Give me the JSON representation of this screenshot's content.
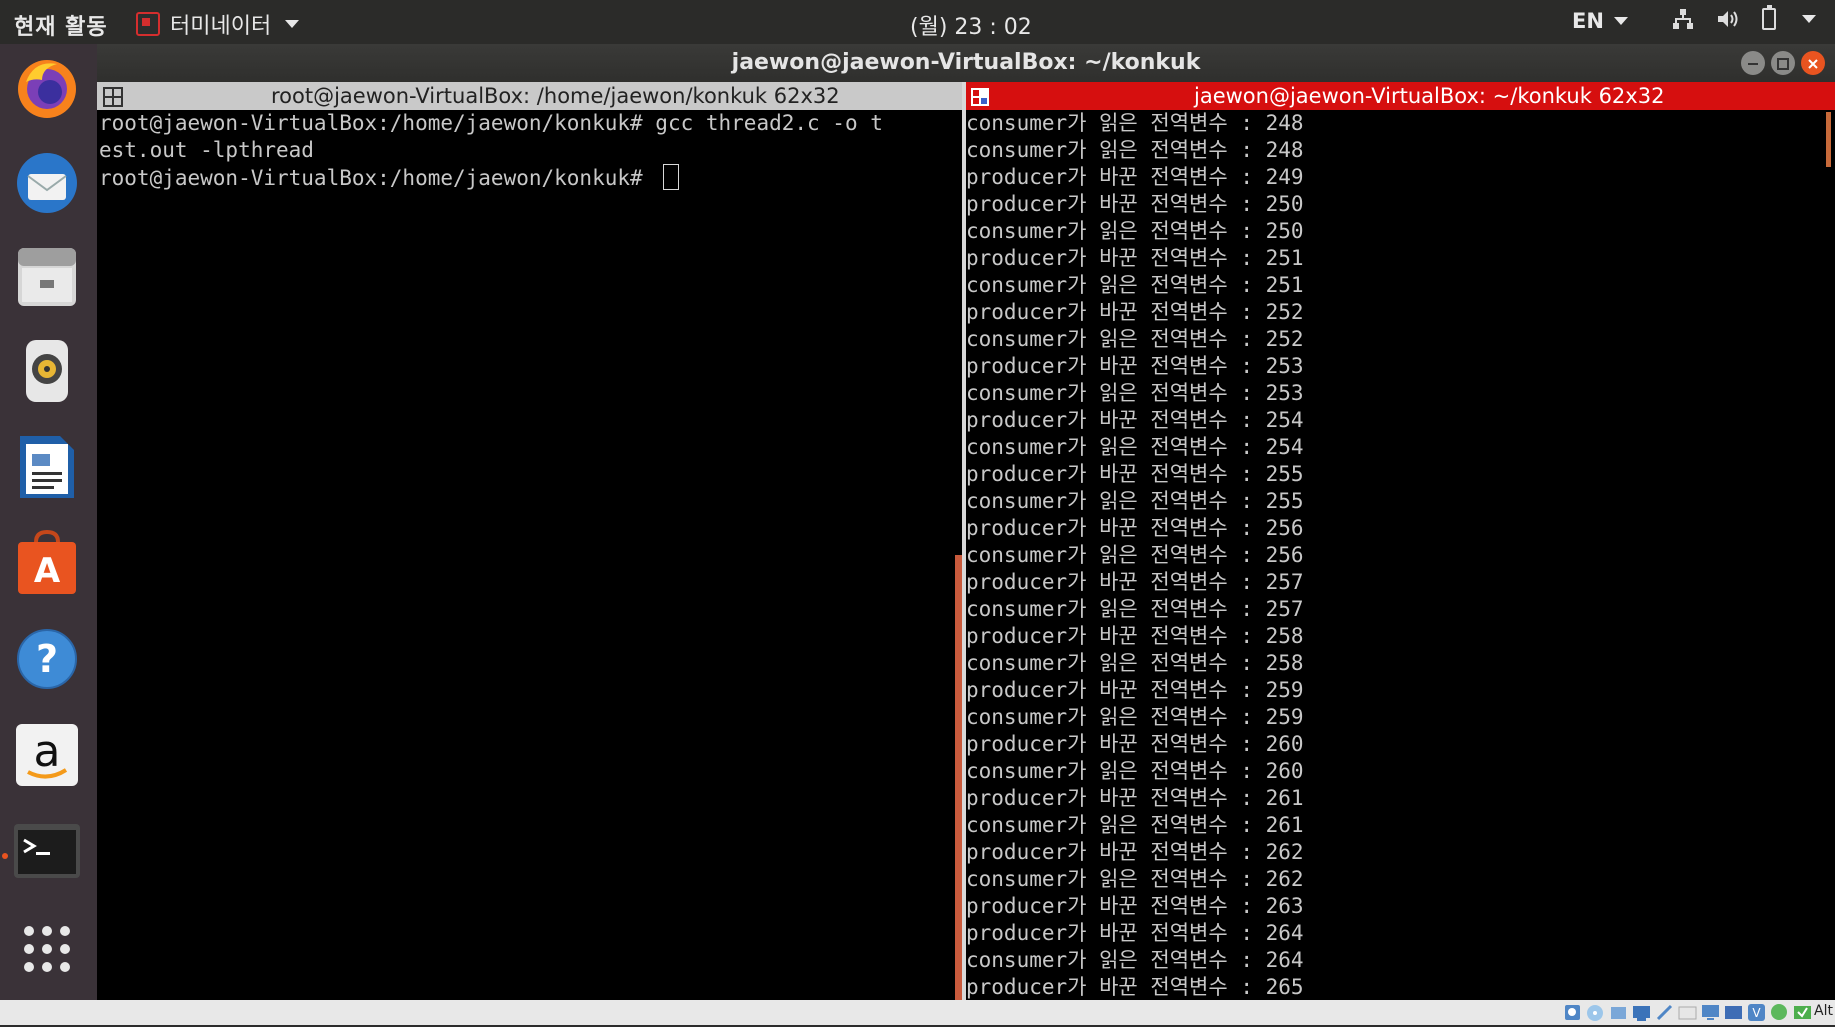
{
  "topbar": {
    "activities": "현재 활동",
    "app_menu": "터미네이터",
    "clock": "(월) 23 : 02",
    "language": "EN"
  },
  "dock": {
    "items": [
      "firefox",
      "thunderbird",
      "files",
      "rhythmbox",
      "writer",
      "software",
      "help",
      "amazon",
      "terminal",
      "show-apps"
    ]
  },
  "window": {
    "title": "jaewon@jaewon-VirtualBox: ~/konkuk"
  },
  "left_pane": {
    "title": "root@jaewon-VirtualBox: /home/jaewon/konkuk 62x32",
    "lines": [
      "root@jaewon-VirtualBox:/home/jaewon/konkuk# gcc thread2.c -o t",
      "est.out -lpthread",
      "root@jaewon-VirtualBox:/home/jaewon/konkuk# "
    ]
  },
  "right_pane": {
    "title": "jaewon@jaewon-VirtualBox: ~/konkuk 62x32",
    "lines": [
      "consumer가 읽은 전역변수 : 248",
      "consumer가 읽은 전역변수 : 248",
      "producer가 바꾼 전역변수 : 249",
      "producer가 바꾼 전역변수 : 250",
      "consumer가 읽은 전역변수 : 250",
      "producer가 바꾼 전역변수 : 251",
      "consumer가 읽은 전역변수 : 251",
      "producer가 바꾼 전역변수 : 252",
      "consumer가 읽은 전역변수 : 252",
      "producer가 바꾼 전역변수 : 253",
      "consumer가 읽은 전역변수 : 253",
      "producer가 바꾼 전역변수 : 254",
      "consumer가 읽은 전역변수 : 254",
      "producer가 바꾼 전역변수 : 255",
      "consumer가 읽은 전역변수 : 255",
      "producer가 바꾼 전역변수 : 256",
      "consumer가 읽은 전역변수 : 256",
      "producer가 바꾼 전역변수 : 257",
      "consumer가 읽은 전역변수 : 257",
      "producer가 바꾼 전역변수 : 258",
      "consumer가 읽은 전역변수 : 258",
      "producer가 바꾼 전역변수 : 259",
      "consumer가 읽은 전역변수 : 259",
      "producer가 바꾼 전역변수 : 260",
      "consumer가 읽은 전역변수 : 260",
      "producer가 바꾼 전역변수 : 261",
      "consumer가 읽은 전역변수 : 261",
      "producer가 바꾼 전역변수 : 262",
      "consumer가 읽은 전역변수 : 262",
      "producer가 바꾼 전역변수 : 263",
      "producer가 바꾼 전역변수 : 264",
      "consumer가 읽은 전역변수 : 264",
      "producer가 바꾼 전역변수 : 265"
    ]
  },
  "statusbar": {
    "host_key": "Alt"
  },
  "colors": {
    "terminal_bg": "#000000",
    "terminal_fg": "#c8c8c8",
    "active_header": "#d60f0f",
    "inactive_header": "#c9c9c9",
    "dock_bg": "#3a3238",
    "topbar_bg": "#2b2b29"
  }
}
